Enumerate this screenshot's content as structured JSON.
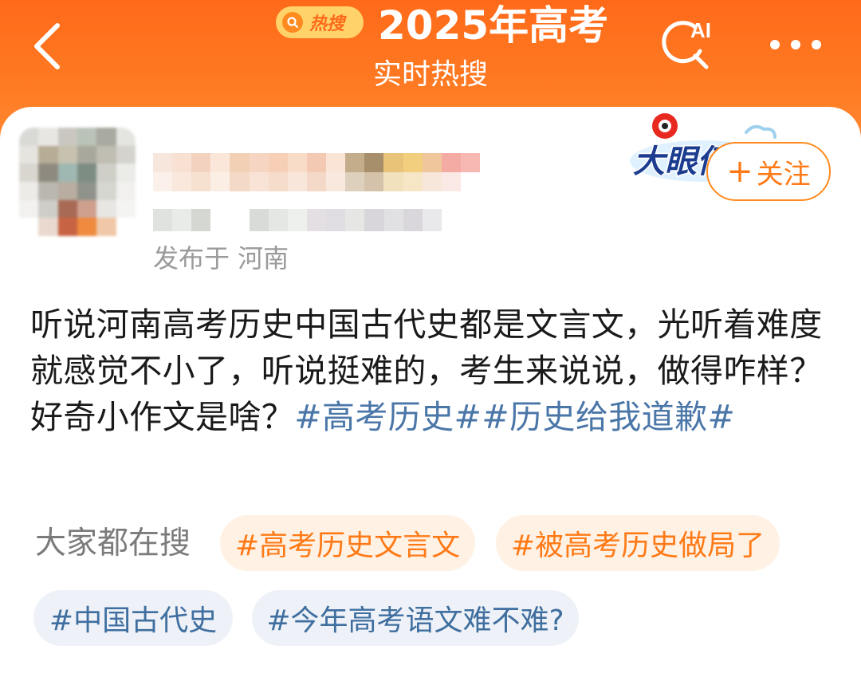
{
  "header": {
    "badge_label": "热搜",
    "title": "2025年高考",
    "subtitle": "实时热搜",
    "ai_label": "AI"
  },
  "post": {
    "location": "发布于 河南",
    "sticker_text": "大眼仔",
    "follow_label": "关注",
    "body_text": "听说河南高考历史中国古代史都是文言文，光听着难度就感觉不小了，听说挺难的，考生来说说，做得咋样？好奇小作文是啥？",
    "hashtags": [
      "#高考历史#",
      "#历史给我道歉#"
    ]
  },
  "related_searches": {
    "label": "大家都在搜",
    "chips": [
      {
        "text": "#高考历史文言文"
      },
      {
        "text": "#被高考历史做局了"
      },
      {
        "text": "#中国古代史"
      },
      {
        "text": "#今年高考语文难不难?"
      }
    ]
  },
  "colors": {
    "header_orange": "#ff6a1a",
    "accent_orange": "#ff7a16",
    "hashtag_blue": "#4a76a8",
    "chip_orange_bg": "#fff1e4",
    "chip_blue_bg": "#eef2f8"
  },
  "icons": [
    "chevron-left-icon",
    "search-icon",
    "ai-search-icon",
    "more-dots-icon"
  ]
}
